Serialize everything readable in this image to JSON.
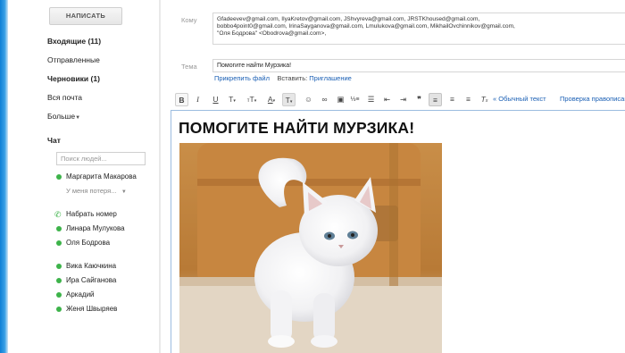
{
  "sidebar": {
    "compose_label": "НАПИСАТЬ",
    "nav": [
      {
        "label": "Входящие (11)",
        "bold": true
      },
      {
        "label": "Отправленные",
        "bold": false
      },
      {
        "label": "Черновики (1)",
        "bold": true
      },
      {
        "label": "Вся почта",
        "bold": false
      },
      {
        "label": "Больше",
        "bold": false
      }
    ],
    "chat_title": "Чат",
    "chat_search_placeholder": "Поиск людей...",
    "contacts_group1": [
      {
        "name": "Маргарита Макарова",
        "kind": "online"
      },
      {
        "name": "У меня потеря...",
        "kind": "status"
      }
    ],
    "contacts_group2": [
      {
        "name": "Набрать номер",
        "kind": "phone"
      },
      {
        "name": "Линара Мулукова",
        "kind": "online"
      },
      {
        "name": "Оля Бодрова",
        "kind": "online"
      }
    ],
    "contacts_group3": [
      {
        "name": "Вика Каючкина",
        "kind": "online"
      },
      {
        "name": "Ира Сайганова",
        "kind": "online"
      },
      {
        "name": "Аркадий",
        "kind": "online"
      },
      {
        "name": "Женя Швыряев",
        "kind": "online"
      }
    ]
  },
  "compose": {
    "to_label": "Кому",
    "to_lines": [
      "Gfadeevev@gmail.com, IlyaKretov@gmail.com, JShvyreva@gmail.com, JRSTKhoused@gmail.com,",
      "bobbo4point0@gmail.com, IrinaSayganova@gmail.com, Lmulukova@gmail.com, MikhailOvchinnikov@gmail.com,",
      "\"Оля Бодрова\" <Obodrova@gmail.com>,"
    ],
    "subject_label": "Тема",
    "subject_value": "Помогите найти Мурзика!",
    "attach_label": "Прикрепить файл",
    "insert_label": "Вставить:",
    "invite_label": "Приглашение"
  },
  "toolbar": {
    "plain_text_link": "« Обычный текст",
    "spellcheck_link": "Проверка правописания"
  },
  "editor": {
    "headline": "ПОМОГИТЕ НАЙТИ МУРЗИКА!"
  },
  "colors": {
    "link": "#1a5fb4",
    "online_dot": "#3db34a",
    "editor_border": "#9cbde0"
  }
}
